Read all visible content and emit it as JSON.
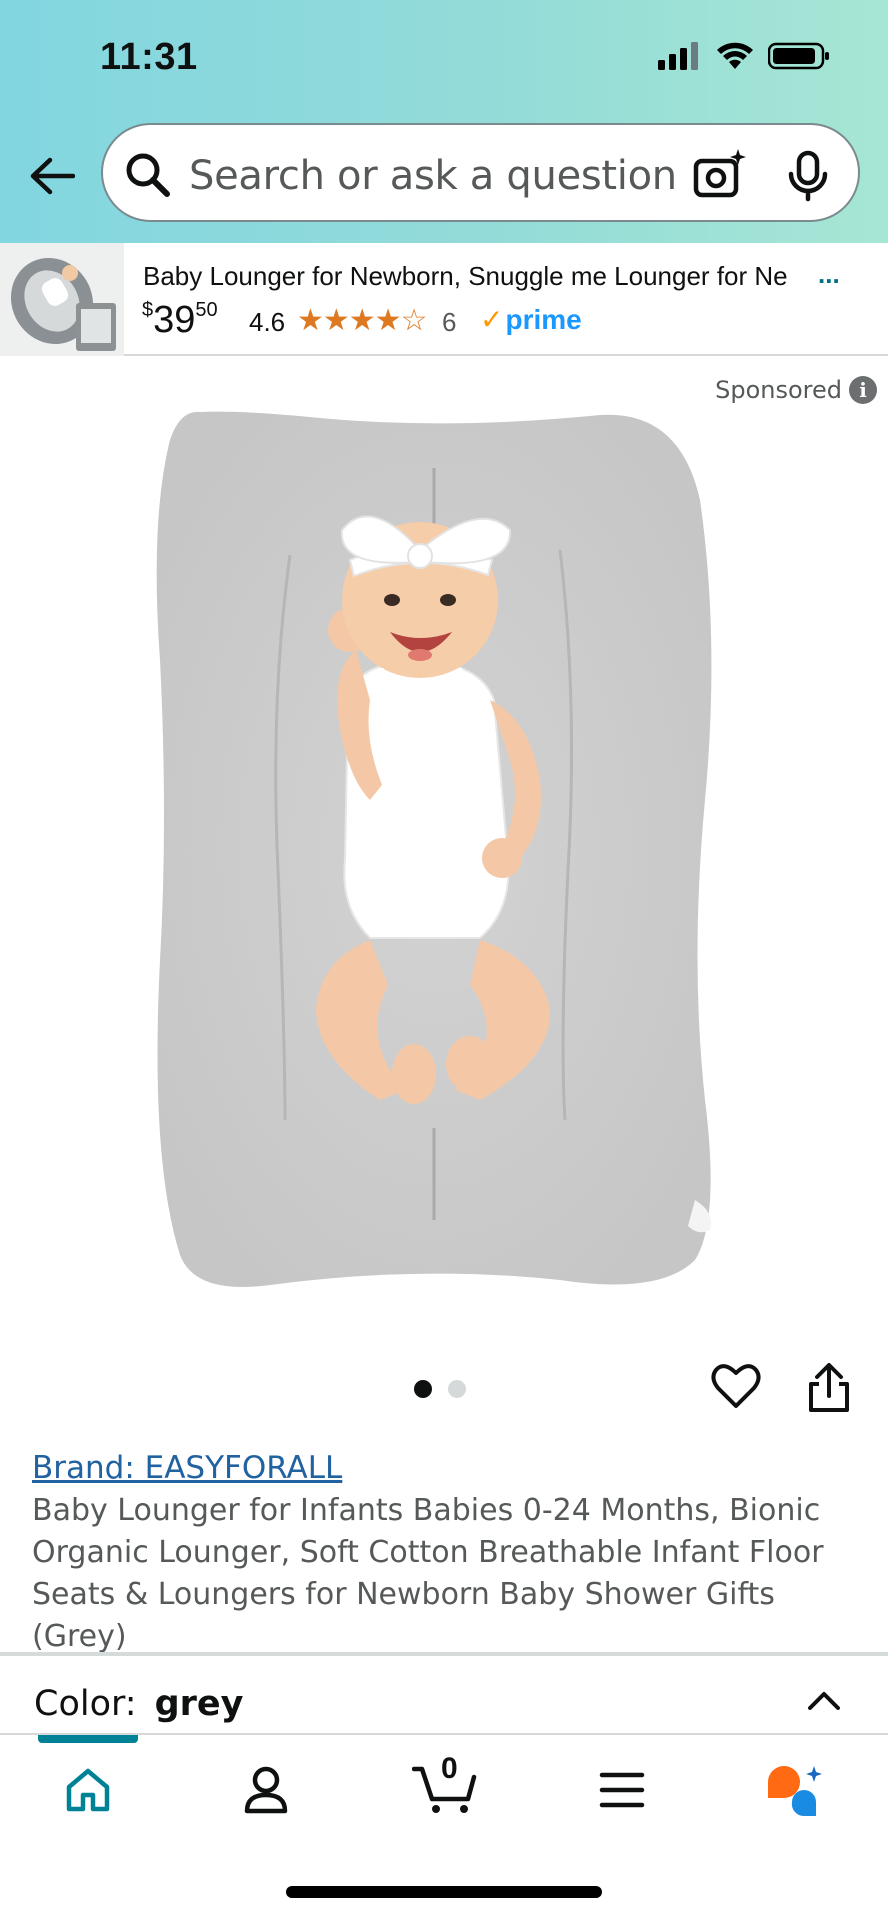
{
  "status_bar": {
    "time": "11:31"
  },
  "search": {
    "placeholder": "Search or ask a question"
  },
  "ad": {
    "title": "Baby Lounger for Newborn, Snuggle me Lounger for Ne",
    "ellipsis": "...",
    "price_symbol": "$",
    "price_whole": "39",
    "price_cents": "50",
    "rating": "4.6",
    "stars": "★★★★☆",
    "rating_value": 4.6,
    "review_count": "6",
    "prime_label": "prime"
  },
  "sponsored_label": "Sponsored",
  "carousel": {
    "total": 2,
    "active": 0
  },
  "product": {
    "brand": "Brand: EASYFORALL",
    "title": "Baby Lounger for Infants Babies 0-24 Months, Bionic Organic Lounger, Soft Cotton Breathable Infant Floor Seats & Loungers for Newborn Baby Shower Gifts (Grey)"
  },
  "variation": {
    "label": "Color:",
    "value": "grey"
  },
  "bottom_nav": {
    "cart_count": "0",
    "items": [
      "home-icon",
      "account-icon",
      "cart-icon",
      "menu-icon",
      "rufus-icon"
    ]
  },
  "colors": {
    "accent": "#008296",
    "link": "#2162a1",
    "star": "#de7921",
    "prime": "#1a98ff"
  }
}
